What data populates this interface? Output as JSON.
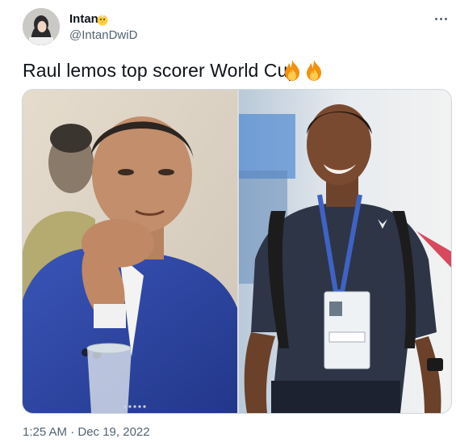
{
  "author": {
    "display_name": "Intan",
    "handle": "@IntanDwiD",
    "name_badge_icon": "baby-chick-icon",
    "avatar_icon": "profile-avatar"
  },
  "menu": {
    "icon": "more-options-icon"
  },
  "tweet": {
    "text": "Raul lemos top scorer World Cup",
    "emoji": [
      "fire-icon",
      "fire-icon"
    ]
  },
  "media": {
    "left_photo": "man-in-blue-suit-photo",
    "right_photo": "smiling-footballer-photo"
  },
  "timestamp": "1:25 AM · Dec 19, 2022",
  "colors": {
    "text_primary": "#0f1419",
    "text_secondary": "#536471",
    "border": "#cfd9de"
  }
}
